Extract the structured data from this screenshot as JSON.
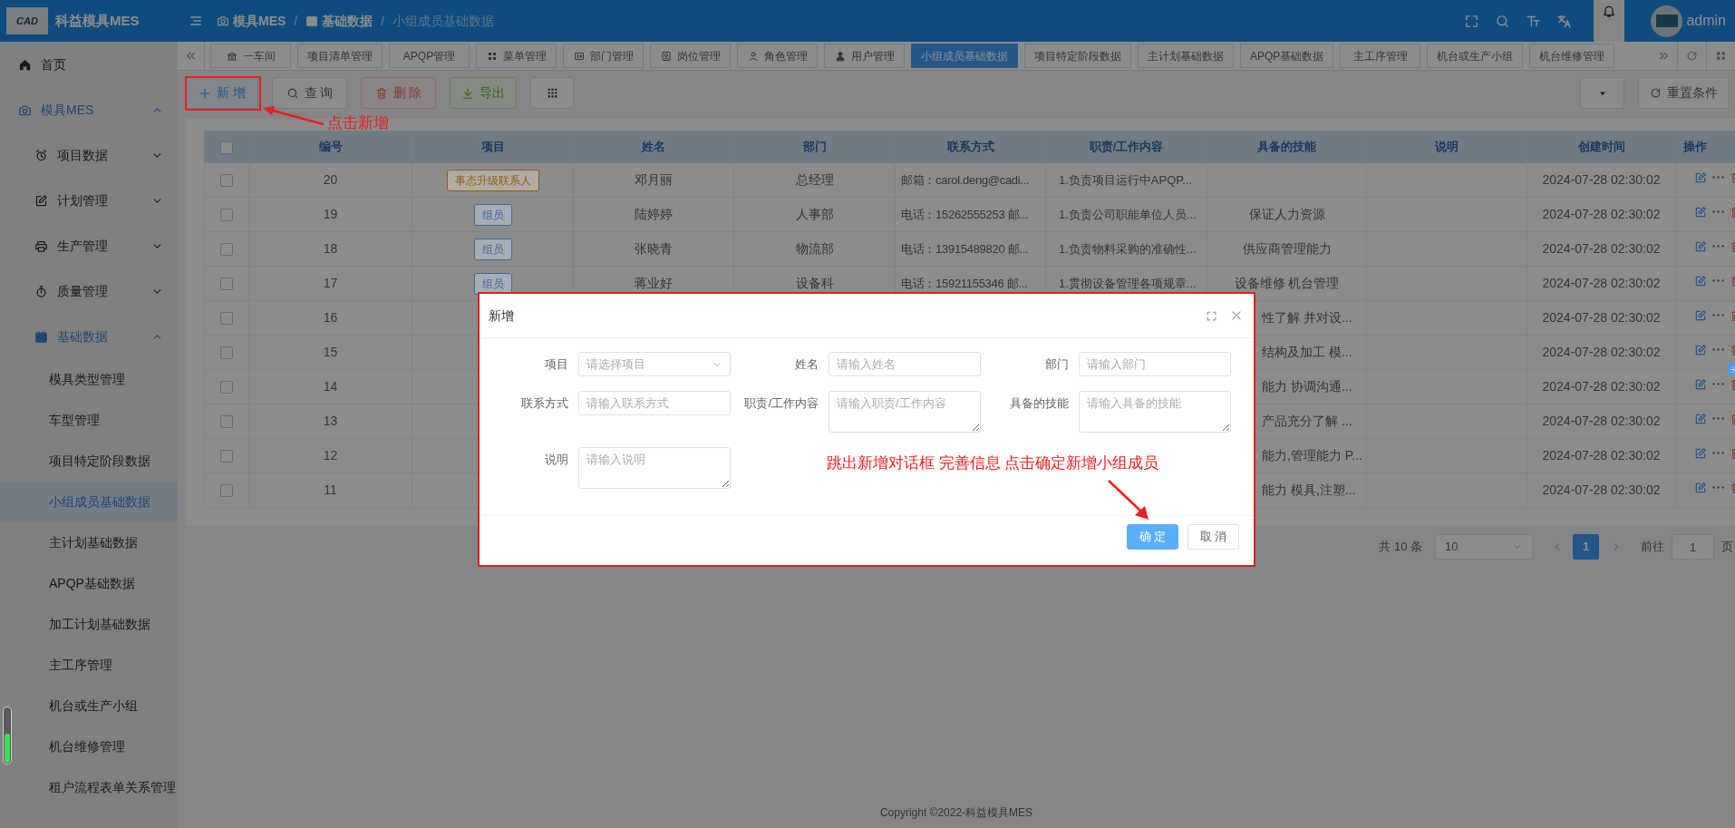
{
  "brand": {
    "logo_text": "CAD",
    "name": "科益模具MES"
  },
  "sidebar": {
    "items": [
      {
        "label": "首页",
        "selected": false
      },
      {
        "label": "模具MES",
        "selected": false,
        "expanded": true,
        "children": [
          {
            "label": "项目数据",
            "selected": false,
            "expanded": false
          },
          {
            "label": "计划管理",
            "selected": false,
            "expanded": false
          },
          {
            "label": "生产管理",
            "selected": false,
            "expanded": false
          },
          {
            "label": "质量管理",
            "selected": false,
            "expanded": false
          },
          {
            "label": "基础数据",
            "selected": false,
            "expanded": true,
            "children": [
              {
                "label": "模具类型管理",
                "selected": false
              },
              {
                "label": "车型管理",
                "selected": false
              },
              {
                "label": "项目特定阶段数据",
                "selected": false
              },
              {
                "label": "小组成员基础数据",
                "selected": true
              },
              {
                "label": "主计划基础数据",
                "selected": false
              },
              {
                "label": "APQP基础数据",
                "selected": false
              },
              {
                "label": "加工计划基础数据",
                "selected": false
              },
              {
                "label": "主工序管理",
                "selected": false
              },
              {
                "label": "机台或生产小组",
                "selected": false
              },
              {
                "label": "机台维修管理",
                "selected": false
              },
              {
                "label": "租户流程表单关系管理",
                "selected": false
              }
            ]
          }
        ]
      }
    ]
  },
  "header": {
    "breadcrumbs": [
      {
        "label": "模具MES",
        "current": false
      },
      {
        "label": "基础数据",
        "current": false
      },
      {
        "label": "小组成员基础数据",
        "current": true
      }
    ],
    "separators": [
      "/",
      "/"
    ],
    "user": {
      "name": "admin"
    }
  },
  "tabs": [
    {
      "label": "一车间",
      "selected": false
    },
    {
      "label": "项目清单管理",
      "selected": false
    },
    {
      "label": "APQP管理",
      "selected": false
    },
    {
      "label": "菜单管理",
      "selected": false
    },
    {
      "label": "部门管理",
      "selected": false
    },
    {
      "label": "岗位管理",
      "selected": false
    },
    {
      "label": "角色管理",
      "selected": false
    },
    {
      "label": "用户管理",
      "selected": false
    },
    {
      "label": "小组成员基础数据",
      "selected": true
    },
    {
      "label": "项目特定阶段数据",
      "selected": false
    },
    {
      "label": "主计划基础数据",
      "selected": false
    },
    {
      "label": "APQP基础数据",
      "selected": false
    },
    {
      "label": "主工序管理",
      "selected": false
    },
    {
      "label": "机台或生产小组",
      "selected": false
    },
    {
      "label": "机台维修管理",
      "selected": false
    }
  ],
  "toolbar": {
    "buttons": [
      {
        "label": "新 增",
        "kind": "primary"
      },
      {
        "label": "查 询",
        "kind": "default"
      },
      {
        "label": "删 除",
        "kind": "danger"
      },
      {
        "label": "导出",
        "kind": "success"
      }
    ],
    "reset_button": "重置条件",
    "annotation": "点击新增"
  },
  "table": {
    "select_all": {
      "checked": false
    },
    "columns": [
      "编号",
      "项目",
      "姓名",
      "部门",
      "联系方式",
      "职责/工作内容",
      "具备的技能",
      "说明",
      "创建时间",
      "操作"
    ],
    "rows": [
      {
        "checked": false,
        "id": "20",
        "tag": {
          "text": "事态升级联系人",
          "color": "#8f5d17"
        },
        "name": "邓月丽",
        "dept": "总经理",
        "contact": "邮箱：carol.deng@cadi...",
        "duties": "1.负责项目运行中APQP...",
        "created": "2024-07-28 02:30:02"
      },
      {
        "checked": false,
        "id": "19",
        "tag": {
          "text": "组员",
          "color": "#3d6a9a"
        },
        "name": "陆婷婷",
        "dept": "人事部",
        "contact": "电话：15262555253 邮...",
        "duties": "1.负责公司职能单位人员...",
        "skills": "保证人力资源",
        "created": "2024-07-28 02:30:02"
      },
      {
        "checked": false,
        "id": "18",
        "tag": {
          "text": "组员",
          "color": "#3d6a9a"
        },
        "name": "张晓青",
        "dept": "物流部",
        "contact": "电话：13915489820 邮...",
        "duties": "1.负责物料采购的准确性...",
        "skills": "供应商管理能力",
        "created": "2024-07-28 02:30:02"
      },
      {
        "checked": false,
        "id": "17",
        "tag": {
          "text": "组员",
          "color": "#3d6a9a"
        },
        "name": "蒋业好",
        "dept": "设备科",
        "contact": "电话：15921155346 邮...",
        "duties": "1.贯彻设备管理各项规章...",
        "skills": "设备维修 机台管理",
        "created": "2024-07-28 02:30:02"
      },
      {
        "checked": false,
        "id": "16",
        "skills": "性了解 并对设...",
        "created": "2024-07-28 02:30:02"
      },
      {
        "checked": false,
        "id": "15",
        "skills": "结构及加工 模...",
        "created": "2024-07-28 02:30:02"
      },
      {
        "checked": false,
        "id": "14",
        "skills": "能力 协调沟通...",
        "created": "2024-07-28 02:30:02"
      },
      {
        "checked": false,
        "id": "13",
        "skills": "产品充分了解 ...",
        "created": "2024-07-28 02:30:02"
      },
      {
        "checked": false,
        "id": "12",
        "skills": "能力,管理能力 P...",
        "created": "2024-07-28 02:30:02"
      },
      {
        "checked": false,
        "id": "11",
        "skills": "能力 模具,注塑...",
        "created": "2024-07-28 02:30:02"
      }
    ]
  },
  "pagination": {
    "total": "共 10 条",
    "page_size": "10",
    "pages": [
      {
        "label": "1",
        "selected": true
      }
    ],
    "goto_label": "前往",
    "goto_value": "1",
    "goto_suffix": "页"
  },
  "dialog": {
    "title": "新增",
    "fields": [
      {
        "label": "项目",
        "placeholder": "请选择项目",
        "kind": "select"
      },
      {
        "label": "姓名",
        "placeholder": "请输入姓名",
        "kind": "input"
      },
      {
        "label": "部门",
        "placeholder": "请输入部门",
        "kind": "input"
      },
      {
        "label": "联系方式",
        "placeholder": "请输入联系方式",
        "kind": "input"
      },
      {
        "label": "职责/工作内容",
        "placeholder": "请输入职责/工作内容",
        "kind": "textarea"
      },
      {
        "label": "具备的技能",
        "placeholder": "请输入具备的技能",
        "kind": "textarea"
      },
      {
        "label": "说明",
        "placeholder": "请输入说明",
        "kind": "textarea"
      }
    ],
    "annotation": "跳出新增对话框 完善信息 点击确定新增小组成员",
    "buttons": [
      {
        "label": "确 定",
        "kind": "primary"
      },
      {
        "label": "取 消",
        "kind": "default"
      }
    ]
  },
  "footer": {
    "copyright": "Copyright ©2022-科益模具MES"
  }
}
